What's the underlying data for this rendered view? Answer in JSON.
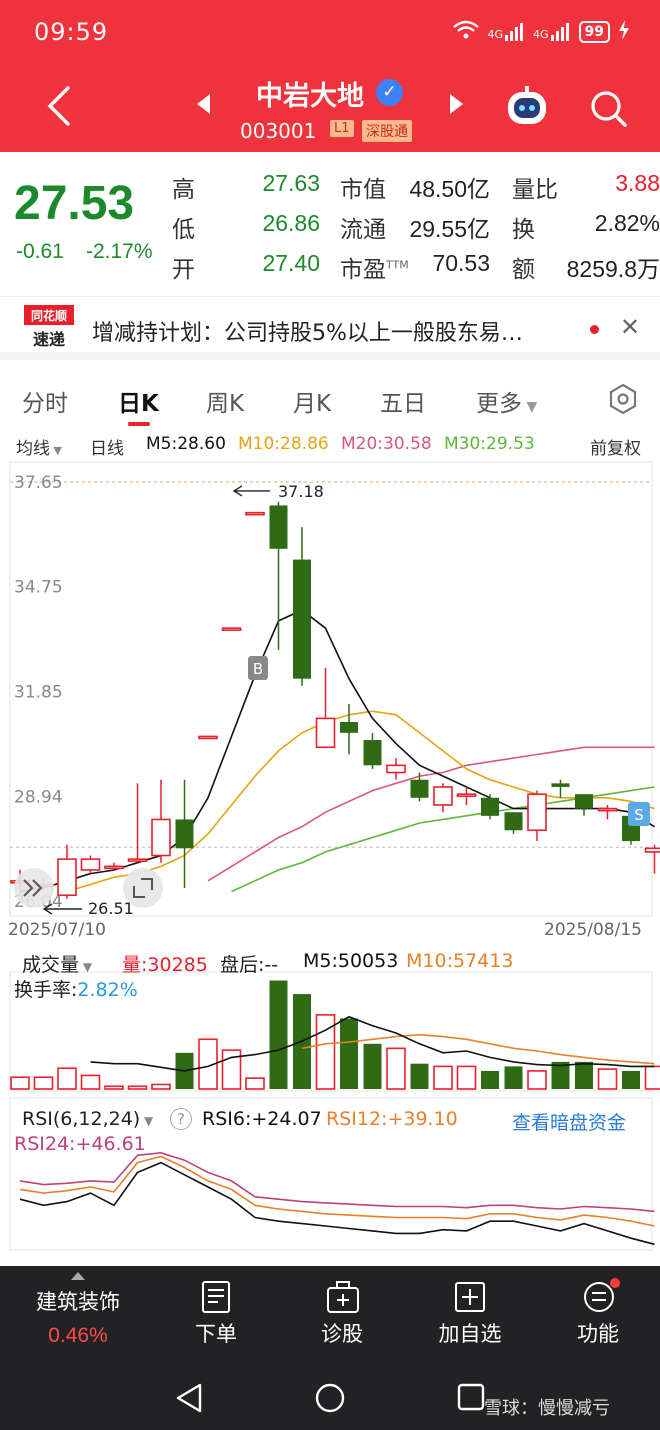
{
  "status": {
    "time": "09:59",
    "signal1": "4G",
    "signal2": "4G",
    "battery": "99"
  },
  "header": {
    "name": "中岩大地",
    "code": "003001",
    "tag_level": "L1",
    "tag_market": "深股通"
  },
  "quote": {
    "price": "27.53",
    "change": "-0.61",
    "change_pct": "-2.17%",
    "labels": {
      "high": "高",
      "low": "低",
      "open": "开",
      "mktcap": "市值",
      "float": "流通",
      "pe": "市盈",
      "pe_sup": "TTM",
      "volratio": "量比",
      "turnover": "换",
      "amount": "额"
    },
    "high": "27.63",
    "low": "26.86",
    "open": "27.40",
    "mktcap": "48.50亿",
    "float": "29.55亿",
    "pe": "70.53",
    "volratio": "3.88",
    "turnover": "2.82%",
    "amount": "8259.8万"
  },
  "news": {
    "logo_top": "同花顺",
    "logo_bottom": "速递",
    "text": "增减持计划：公司持股5%以上一般股东易…"
  },
  "tabs": [
    "分时",
    "日K",
    "周K",
    "月K",
    "五日",
    "更多"
  ],
  "ma_legend": {
    "mode": "均线",
    "period": "日线",
    "m5": "M5:28.60",
    "m10": "M10:28.86",
    "m20": "M20:30.58",
    "m30": "M30:29.53",
    "adjust": "前复权"
  },
  "colors": {
    "up": "#e8202c",
    "down": "#2f6a14",
    "m5": "#111111",
    "m10": "#e6a413",
    "m20": "#d9577b",
    "m30": "#5cb83a",
    "header": "#f0323c"
  },
  "chart_data": {
    "type": "candlestick",
    "y_ticks": [
      "37.65",
      "34.75",
      "31.85",
      "28.94",
      "26.04"
    ],
    "ylim": [
      26.04,
      37.65
    ],
    "date_start": "2025/07/10",
    "date_end": "2025/08/15",
    "max_label": "37.18",
    "min_label": "26.51",
    "markers": {
      "buy": "B",
      "sell": "S"
    },
    "candles": [
      {
        "o": 26.6,
        "c": 26.6,
        "h": 26.9,
        "l": 26.3
      },
      {
        "o": 26.5,
        "c": 26.5,
        "h": 26.7,
        "l": 26.4
      },
      {
        "o": 26.2,
        "c": 27.2,
        "h": 27.6,
        "l": 26.1
      },
      {
        "o": 26.9,
        "c": 27.2,
        "h": 27.3,
        "l": 26.8
      },
      {
        "o": 27.0,
        "c": 27.0,
        "h": 27.1,
        "l": 26.9
      },
      {
        "o": 27.2,
        "c": 27.2,
        "h": 29.3,
        "l": 27.1
      },
      {
        "o": 27.3,
        "c": 28.3,
        "h": 29.4,
        "l": 27.1
      },
      {
        "o": 28.3,
        "c": 27.5,
        "h": 29.4,
        "l": 26.4
      },
      {
        "o": 30.6,
        "c": 30.6,
        "h": 30.6,
        "l": 30.6
      },
      {
        "o": 33.6,
        "c": 33.6,
        "h": 33.6,
        "l": 33.6
      },
      {
        "o": 36.8,
        "c": 36.8,
        "h": 36.8,
        "l": 36.8
      },
      {
        "o": 37.0,
        "c": 35.8,
        "h": 37.1,
        "l": 33.0
      },
      {
        "o": 35.5,
        "c": 32.2,
        "h": 36.4,
        "l": 32.0
      },
      {
        "o": 30.3,
        "c": 31.1,
        "h": 32.5,
        "l": 30.3
      },
      {
        "o": 31.0,
        "c": 30.7,
        "h": 31.5,
        "l": 30.1
      },
      {
        "o": 30.5,
        "c": 29.8,
        "h": 30.7,
        "l": 29.7
      },
      {
        "o": 29.6,
        "c": 29.8,
        "h": 30.0,
        "l": 29.4
      },
      {
        "o": 29.4,
        "c": 28.9,
        "h": 29.6,
        "l": 28.8
      },
      {
        "o": 28.7,
        "c": 29.2,
        "h": 29.3,
        "l": 28.5
      },
      {
        "o": 29.0,
        "c": 29.0,
        "h": 29.2,
        "l": 28.7
      },
      {
        "o": 28.9,
        "c": 28.4,
        "h": 29.0,
        "l": 28.3
      },
      {
        "o": 28.5,
        "c": 28.0,
        "h": 28.5,
        "l": 27.9
      },
      {
        "o": 28.0,
        "c": 29.0,
        "h": 29.1,
        "l": 27.7
      },
      {
        "o": 29.3,
        "c": 29.2,
        "h": 29.4,
        "l": 28.9
      },
      {
        "o": 29.0,
        "c": 28.6,
        "h": 29.0,
        "l": 28.4
      },
      {
        "o": 28.6,
        "c": 28.6,
        "h": 28.7,
        "l": 28.3
      },
      {
        "o": 28.4,
        "c": 27.7,
        "h": 28.5,
        "l": 27.6
      },
      {
        "o": 27.4,
        "c": 27.5,
        "h": 27.6,
        "l": 26.8
      }
    ],
    "ma5": [
      26.3,
      26.4,
      26.6,
      26.8,
      26.9,
      27.1,
      27.3,
      27.8,
      28.9,
      30.6,
      32.3,
      33.8,
      34.1,
      33.6,
      32.2,
      31.1,
      30.4,
      29.8,
      29.5,
      29.2,
      28.9,
      28.6,
      28.6,
      28.6,
      28.6,
      28.6,
      28.5,
      28.1
    ],
    "ma10": [
      null,
      null,
      26.3,
      26.5,
      26.7,
      26.8,
      27.0,
      27.3,
      27.9,
      28.7,
      29.5,
      30.2,
      30.7,
      31.0,
      31.2,
      31.3,
      31.2,
      30.7,
      30.2,
      29.7,
      29.4,
      29.2,
      29.0,
      28.9,
      28.9,
      28.9,
      28.8,
      28.6
    ],
    "ma20": [
      null,
      null,
      null,
      null,
      null,
      null,
      null,
      null,
      26.6,
      27.0,
      27.4,
      27.8,
      28.1,
      28.5,
      28.8,
      29.1,
      29.3,
      29.5,
      29.6,
      29.8,
      29.9,
      30.0,
      30.1,
      30.2,
      30.3,
      30.3,
      30.3,
      30.3
    ],
    "ma30": [
      null,
      null,
      null,
      null,
      null,
      null,
      null,
      null,
      null,
      26.3,
      26.6,
      26.9,
      27.1,
      27.4,
      27.6,
      27.8,
      28.0,
      28.2,
      28.3,
      28.4,
      28.5,
      28.6,
      28.7,
      28.8,
      28.9,
      29.0,
      29.1,
      29.2
    ],
    "volume": [
      13,
      13,
      23,
      15,
      3,
      3,
      5,
      40,
      55,
      43,
      12,
      120,
      105,
      82,
      78,
      50,
      45,
      28,
      25,
      25,
      20,
      25,
      20,
      30,
      30,
      22,
      20,
      25
    ],
    "vol_ma": [
      null,
      null,
      null,
      30,
      28,
      28,
      24,
      20,
      25,
      35,
      38,
      43,
      53,
      65,
      80,
      70,
      62,
      50,
      40,
      42,
      35,
      30,
      27,
      26,
      28,
      27,
      25,
      25
    ],
    "vol_ma10": [
      null,
      null,
      null,
      null,
      null,
      null,
      null,
      null,
      null,
      null,
      null,
      null,
      45,
      50,
      52,
      55,
      58,
      60,
      58,
      55,
      50,
      45,
      42,
      38,
      35,
      32,
      30,
      28
    ],
    "rsi6": [
      40,
      35,
      38,
      45,
      35,
      62,
      70,
      60,
      50,
      40,
      25,
      22,
      20,
      18,
      16,
      14,
      12,
      12,
      15,
      14,
      22,
      22,
      18,
      14,
      20,
      14,
      8,
      3
    ],
    "rsi12": [
      48,
      45,
      47,
      50,
      46,
      70,
      75,
      66,
      55,
      48,
      35,
      32,
      30,
      28,
      27,
      26,
      25,
      25,
      25,
      24,
      28,
      28,
      25,
      23,
      27,
      25,
      22,
      18
    ],
    "rsi24": [
      55,
      52,
      53,
      55,
      54,
      76,
      78,
      72,
      62,
      55,
      42,
      40,
      38,
      37,
      36,
      35,
      34,
      34,
      34,
      33,
      35,
      35,
      33,
      32,
      34,
      33,
      32,
      30
    ]
  },
  "volume_panel": {
    "title": "成交量",
    "vol": "量:30285",
    "after": "盘后:--",
    "m5": "M5:50053",
    "m10": "M10:57413",
    "turnover_label": "换手率:",
    "turnover_value": "2.82%"
  },
  "rsi_panel": {
    "title": "RSI(6,12,24)",
    "help": "?",
    "rsi6": "RSI6:+24.07",
    "rsi12": "RSI12:+39.10",
    "rsi24": "RSI24:+46.61",
    "link": "查看暗盘资金"
  },
  "bottom": {
    "sector": "建筑装饰",
    "sector_pct": "0.46%",
    "items": [
      "下单",
      "诊股",
      "加自选",
      "功能"
    ]
  },
  "watermark": "雪球：慢慢减亏"
}
